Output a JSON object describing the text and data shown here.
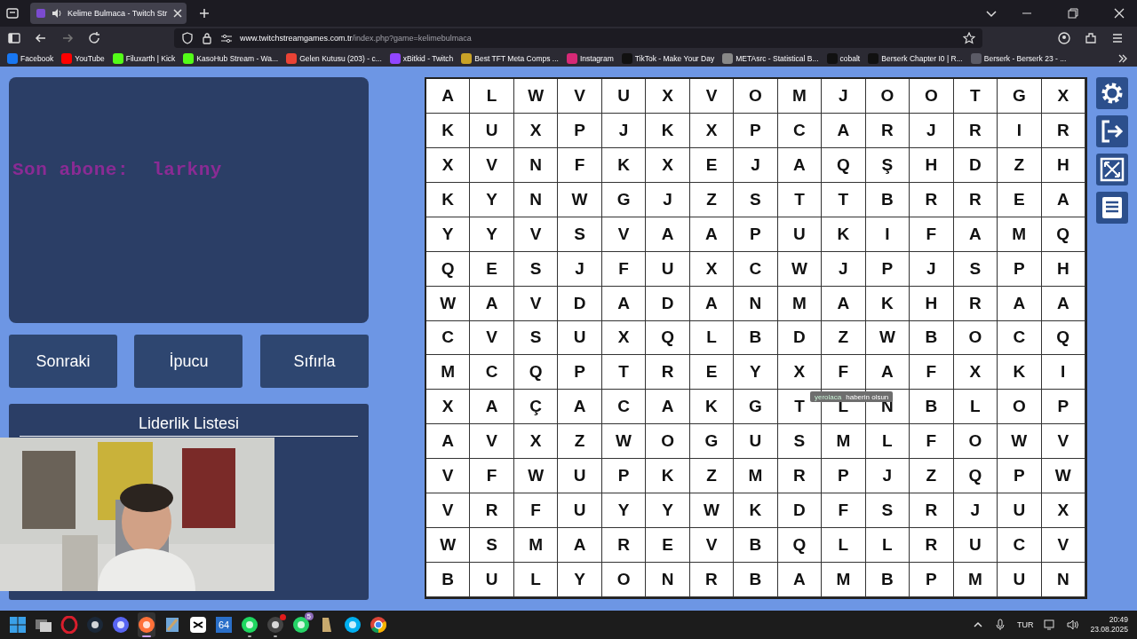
{
  "browser": {
    "tabs": [
      {
        "title": "Kelime Bulmaca - Twitch Str",
        "selected": true
      }
    ],
    "url": {
      "host": "www.twitchstreamgames.com.tr",
      "path": "/index.php?game=kelimebulmaca"
    },
    "bookmarks": [
      {
        "label": "Facebook",
        "color": "#1877f2"
      },
      {
        "label": "YouTube",
        "color": "#ff0000"
      },
      {
        "label": "Filuxarth | Kick",
        "color": "#53fc18"
      },
      {
        "label": "KasoHub Stream - Wa...",
        "color": "#53fc18"
      },
      {
        "label": "Gelen Kutusu (203) - c...",
        "color": "#ea4335"
      },
      {
        "label": "xBitkid - Twitch",
        "color": "#9146ff"
      },
      {
        "label": "Best TFT Meta Comps ...",
        "color": "#c9a227"
      },
      {
        "label": "Instagram",
        "color": "#d62976"
      },
      {
        "label": "TikTok - Make Your Day",
        "color": "#111111"
      },
      {
        "label": "METAsrc - Statistical B...",
        "color": "#888888"
      },
      {
        "label": "cobalt",
        "color": "#111111"
      },
      {
        "label": "Berserk Chapter I0 | R...",
        "color": "#111111"
      },
      {
        "label": "Berserk - Berserk 23 - ...",
        "color": "#5b5b66"
      }
    ]
  },
  "game": {
    "last_subscriber": "Son abone:  larkny",
    "buttons": [
      "Sonraki",
      "İpucu",
      "Sıfırla"
    ],
    "leaderboard": {
      "title": "Liderlik Listesi"
    },
    "grid": [
      [
        "A",
        "L",
        "W",
        "V",
        "U",
        "X",
        "V",
        "O",
        "M",
        "J",
        "O",
        "O",
        "T",
        "G",
        "X"
      ],
      [
        "K",
        "U",
        "X",
        "P",
        "J",
        "K",
        "X",
        "P",
        "C",
        "A",
        "R",
        "J",
        "R",
        "I",
        "R"
      ],
      [
        "X",
        "V",
        "N",
        "F",
        "K",
        "X",
        "E",
        "J",
        "A",
        "Q",
        "Ş",
        "H",
        "D",
        "Z",
        "H"
      ],
      [
        "K",
        "Y",
        "N",
        "W",
        "G",
        "J",
        "Z",
        "S",
        "T",
        "T",
        "B",
        "R",
        "R",
        "E",
        "A"
      ],
      [
        "Y",
        "Y",
        "V",
        "S",
        "V",
        "A",
        "A",
        "P",
        "U",
        "K",
        "I",
        "F",
        "A",
        "M",
        "Q"
      ],
      [
        "Q",
        "E",
        "S",
        "J",
        "F",
        "U",
        "X",
        "C",
        "W",
        "J",
        "P",
        "J",
        "S",
        "P",
        "H"
      ],
      [
        "W",
        "A",
        "V",
        "D",
        "A",
        "D",
        "A",
        "N",
        "M",
        "A",
        "K",
        "H",
        "R",
        "A",
        "A"
      ],
      [
        "C",
        "V",
        "S",
        "U",
        "X",
        "Q",
        "L",
        "B",
        "D",
        "Z",
        "W",
        "B",
        "O",
        "C",
        "Q"
      ],
      [
        "M",
        "C",
        "Q",
        "P",
        "T",
        "R",
        "E",
        "Y",
        "X",
        "F",
        "A",
        "F",
        "X",
        "K",
        "I"
      ],
      [
        "X",
        "A",
        "Ç",
        "A",
        "C",
        "A",
        "K",
        "G",
        "T",
        "L",
        "N",
        "B",
        "L",
        "O",
        "P"
      ],
      [
        "A",
        "V",
        "X",
        "Z",
        "W",
        "O",
        "G",
        "U",
        "S",
        "M",
        "L",
        "F",
        "O",
        "W",
        "V"
      ],
      [
        "V",
        "F",
        "W",
        "U",
        "P",
        "K",
        "Z",
        "M",
        "R",
        "P",
        "J",
        "Z",
        "Q",
        "P",
        "W"
      ],
      [
        "V",
        "R",
        "F",
        "U",
        "Y",
        "Y",
        "W",
        "K",
        "D",
        "F",
        "S",
        "R",
        "J",
        "U",
        "X"
      ],
      [
        "W",
        "S",
        "M",
        "A",
        "R",
        "E",
        "V",
        "B",
        "Q",
        "L",
        "L",
        "R",
        "U",
        "C",
        "V"
      ],
      [
        "B",
        "U",
        "L",
        "Y",
        "O",
        "N",
        "R",
        "B",
        "A",
        "M",
        "B",
        "P",
        "M",
        "U",
        "N"
      ]
    ],
    "tools": [
      {
        "kind": "settings"
      },
      {
        "kind": "exit"
      },
      {
        "kind": "fullscreen"
      },
      {
        "kind": "document"
      }
    ]
  },
  "stream_overlay": {
    "alert": {
      "user": "yerolaca",
      "message": "haberin olsun"
    }
  },
  "taskbar": {
    "apps": [
      {
        "kind": "start",
        "selected": false,
        "running": false,
        "notification": false
      },
      {
        "kind": "taskview",
        "selected": false,
        "running": false,
        "notification": false
      },
      {
        "kind": "opera",
        "selected": false,
        "running": false,
        "notification": false
      },
      {
        "kind": "steam",
        "selected": false,
        "running": false,
        "notification": false
      },
      {
        "kind": "discord",
        "selected": false,
        "running": false,
        "notification": false
      },
      {
        "kind": "firefox",
        "selected": true,
        "running": true,
        "notification": false
      },
      {
        "kind": "notes",
        "selected": false,
        "running": false,
        "notification": false
      },
      {
        "kind": "capcut",
        "selected": false,
        "running": false,
        "notification": false
      },
      {
        "kind": "tile",
        "label": "64",
        "selected": false,
        "running": false,
        "notification": false
      },
      {
        "kind": "spotify",
        "selected": false,
        "running": true,
        "notification": false
      },
      {
        "kind": "obs",
        "selected": false,
        "running": true,
        "notification": true
      },
      {
        "kind": "whatsapp",
        "badge": "5",
        "selected": false,
        "running": false,
        "notification": false
      },
      {
        "kind": "league",
        "selected": false,
        "running": false,
        "notification": false
      },
      {
        "kind": "skype",
        "selected": false,
        "running": false,
        "notification": false
      },
      {
        "kind": "chrome",
        "selected": false,
        "running": false,
        "notification": false
      }
    ],
    "language": "TUR",
    "time": "20:49",
    "date": "23.08.2025"
  }
}
